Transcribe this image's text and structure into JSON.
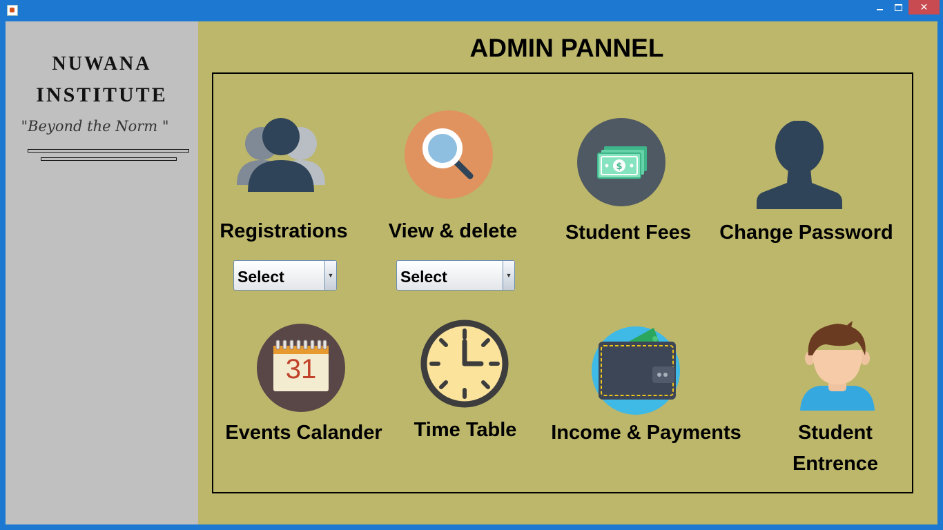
{
  "window": {
    "close_glyph": "✕",
    "min_glyph": "",
    "max_glyph": ""
  },
  "sidebar": {
    "name_line1": "NUWANA",
    "name_line2": "INSTITUTE",
    "tagline": "\"Beyond the Norm \""
  },
  "header": {
    "title": "ADMIN PANNEL"
  },
  "tiles": {
    "registrations": {
      "label": "Registrations",
      "icon": "users-icon",
      "select_value": "Select"
    },
    "view_delete": {
      "label": "View & delete",
      "icon": "search-icon",
      "select_value": "Select"
    },
    "student_fees": {
      "label": "Student Fees",
      "icon": "money-icon"
    },
    "change_password": {
      "label": "Change Password",
      "icon": "user-silhouette-icon"
    },
    "events_calendar": {
      "label": "Events Calander",
      "icon": "calendar-icon",
      "calendar_day": "31"
    },
    "time_table": {
      "label": "Time Table",
      "icon": "clock-icon"
    },
    "income_payments": {
      "label": "Income & Payments",
      "icon": "wallet-icon"
    },
    "student_entrance": {
      "label_line1": "Student",
      "label_line2": "Entrence",
      "icon": "student-avatar-icon"
    }
  },
  "colors": {
    "main_bg": "#bdb76b",
    "sidebar_bg": "#c0c0c0",
    "window_frame": "#1c78d0",
    "close_button": "#c74b50"
  }
}
